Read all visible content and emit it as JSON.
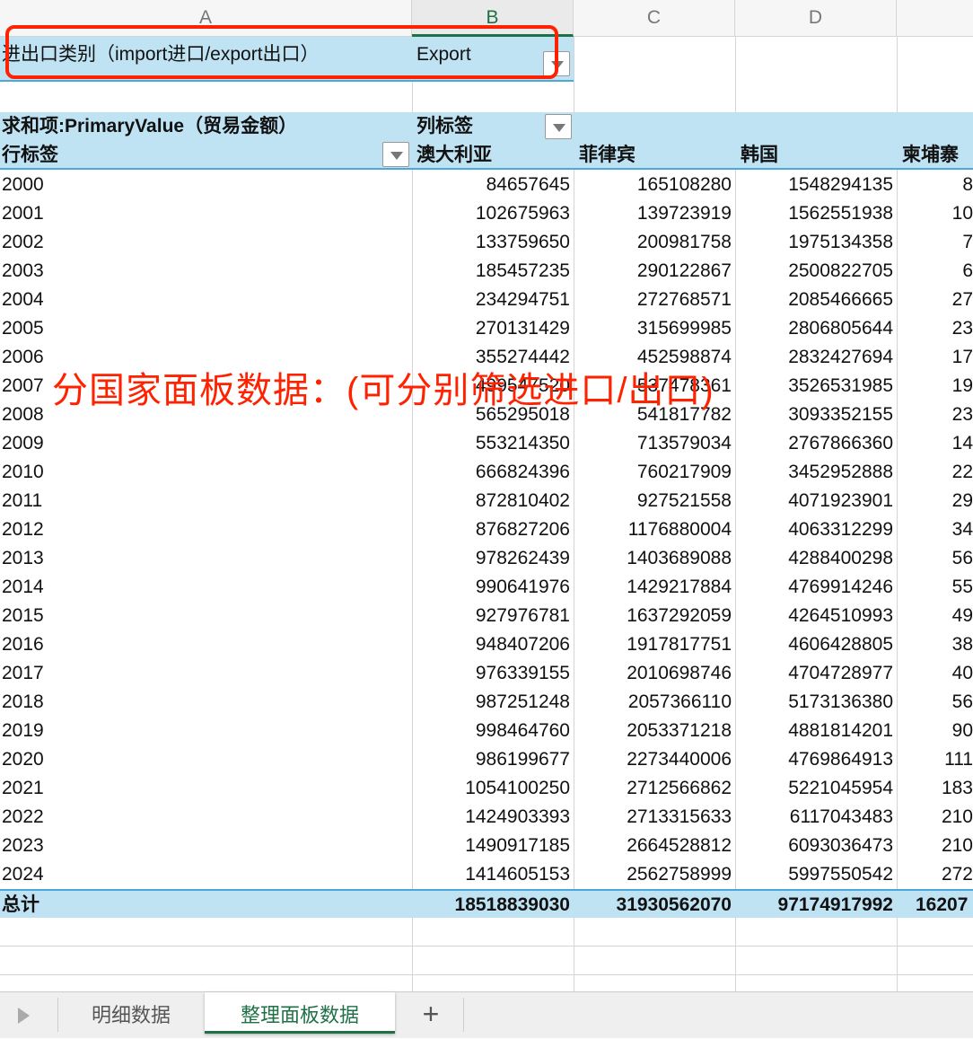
{
  "columns": [
    "A",
    "B",
    "C",
    "D"
  ],
  "filter": {
    "label": "进出口类别（import进口/export出口）",
    "value": "Export"
  },
  "pivot": {
    "value_label": "求和项:PrimaryValue（贸易金额）",
    "col_labels": "列标签",
    "row_labels": "行标签",
    "countries": [
      "澳大利亚",
      "菲律宾",
      "韩国",
      "柬埔寨"
    ],
    "rows": [
      {
        "year": "2000",
        "values": [
          "84657645",
          "165108280",
          "1548294135",
          "8"
        ]
      },
      {
        "year": "2001",
        "values": [
          "102675963",
          "139723919",
          "1562551938",
          "10"
        ]
      },
      {
        "year": "2002",
        "values": [
          "133759650",
          "200981758",
          "1975134358",
          "7"
        ]
      },
      {
        "year": "2003",
        "values": [
          "185457235",
          "290122867",
          "2500822705",
          "6"
        ]
      },
      {
        "year": "2004",
        "values": [
          "234294751",
          "272768571",
          "2085466665",
          "27"
        ]
      },
      {
        "year": "2005",
        "values": [
          "270131429",
          "315699985",
          "2806805644",
          "23"
        ]
      },
      {
        "year": "2006",
        "values": [
          "355274442",
          "452598874",
          "2832427694",
          "17"
        ]
      },
      {
        "year": "2007",
        "values": [
          "499547520",
          "537478361",
          "3526531985",
          "19"
        ]
      },
      {
        "year": "2008",
        "values": [
          "565295018",
          "541817782",
          "3093352155",
          "23"
        ]
      },
      {
        "year": "2009",
        "values": [
          "553214350",
          "713579034",
          "2767866360",
          "14"
        ]
      },
      {
        "year": "2010",
        "values": [
          "666824396",
          "760217909",
          "3452952888",
          "22"
        ]
      },
      {
        "year": "2011",
        "values": [
          "872810402",
          "927521558",
          "4071923901",
          "29"
        ]
      },
      {
        "year": "2012",
        "values": [
          "876827206",
          "1176880004",
          "4063312299",
          "34"
        ]
      },
      {
        "year": "2013",
        "values": [
          "978262439",
          "1403689088",
          "4288400298",
          "56"
        ]
      },
      {
        "year": "2014",
        "values": [
          "990641976",
          "1429217884",
          "4769914246",
          "55"
        ]
      },
      {
        "year": "2015",
        "values": [
          "927976781",
          "1637292059",
          "4264510993",
          "49"
        ]
      },
      {
        "year": "2016",
        "values": [
          "948407206",
          "1917817751",
          "4606428805",
          "38"
        ]
      },
      {
        "year": "2017",
        "values": [
          "976339155",
          "2010698746",
          "4704728977",
          "40"
        ]
      },
      {
        "year": "2018",
        "values": [
          "987251248",
          "2057366110",
          "5173136380",
          "56"
        ]
      },
      {
        "year": "2019",
        "values": [
          "998464760",
          "2053371218",
          "4881814201",
          "90"
        ]
      },
      {
        "year": "2020",
        "values": [
          "986199677",
          "2273440006",
          "4769864913",
          "111"
        ]
      },
      {
        "year": "2021",
        "values": [
          "1054100250",
          "2712566862",
          "5221045954",
          "183"
        ]
      },
      {
        "year": "2022",
        "values": [
          "1424903393",
          "2713315633",
          "6117043483",
          "210"
        ]
      },
      {
        "year": "2023",
        "values": [
          "1490917185",
          "2664528812",
          "6093036473",
          "210"
        ]
      },
      {
        "year": "2024",
        "values": [
          "1414605153",
          "2562758999",
          "5997550542",
          "272"
        ]
      }
    ],
    "total": {
      "label": "总计",
      "values": [
        "18518839030",
        "31930562070",
        "97174917992",
        "16207"
      ]
    }
  },
  "annotation": "分国家面板数据：(可分别筛选进口/出口)",
  "sheet_tabs": [
    {
      "label": "明细数据",
      "active": false
    },
    {
      "label": "整理面板数据",
      "active": true
    }
  ],
  "add_sheet": "+",
  "colors": {
    "pivot_header": "#bfe3f3",
    "highlight": "#ff2200",
    "active_tab": "#1e7145"
  }
}
